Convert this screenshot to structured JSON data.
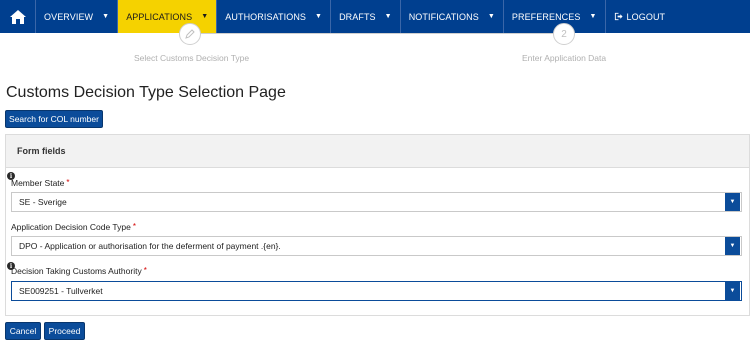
{
  "nav": {
    "home_icon": "home-icon",
    "items": [
      {
        "label": "OVERVIEW",
        "caret": "▼"
      },
      {
        "label": "APPLICATIONS",
        "caret": "▼"
      },
      {
        "label": "AUTHORISATIONS",
        "caret": "▼"
      },
      {
        "label": "DRAFTS",
        "caret": "▼"
      },
      {
        "label": "NOTIFICATIONS",
        "caret": "▼"
      },
      {
        "label": "PREFERENCES",
        "caret": "▼"
      }
    ],
    "logout_label": "LOGOUT",
    "colors": {
      "bar": "#003f8f",
      "active": "#f5d200"
    }
  },
  "wizard": {
    "steps": [
      {
        "label": "Select Customs Decision Type",
        "icon": "pencil-icon"
      },
      {
        "number": "2",
        "label": "Enter Application Data"
      }
    ]
  },
  "page": {
    "title": "Customs Decision Type Selection Page",
    "search_col_label": "Search for COL number"
  },
  "form": {
    "header": "Form fields",
    "fields": [
      {
        "label": "Member State",
        "required": "*",
        "value": "SE - Sverige"
      },
      {
        "label": "Application Decision Code Type",
        "required": "*",
        "value": "DPO - Application or authorisation for the deferment of payment .{en}."
      },
      {
        "label": "Decision Taking Customs Authority",
        "required": "*",
        "value": "SE009251 - Tullverket"
      }
    ]
  },
  "actions": {
    "cancel_label": "Cancel",
    "proceed_label": "Proceed"
  }
}
